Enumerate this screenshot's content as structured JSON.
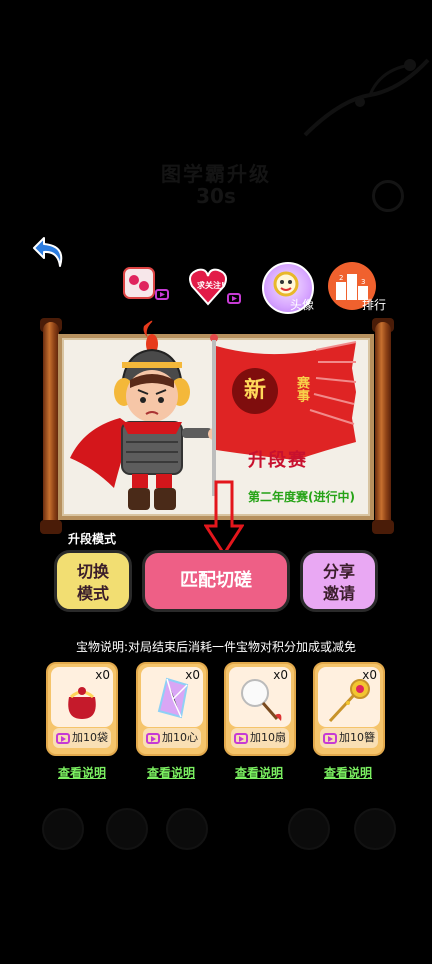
{
  "background": {
    "title": "图学霸升级",
    "timer": "30s"
  },
  "top_icons": {
    "avatar_label": "头像",
    "rank_label": "排行",
    "heart_text": "求关注!"
  },
  "scroll": {
    "flag_new": "新",
    "flag_sai": "赛事",
    "flag_sub": "升段赛",
    "season": "第二年度赛(进行中)"
  },
  "mode": {
    "label": "升段模式",
    "switch_label": "切换模式",
    "match_label": "匹配切磋",
    "share_label": "分享邀请"
  },
  "treasure_note": "宝物说明:对局结束后消耗一件宝物对积分加成或减免",
  "items": [
    {
      "count": "x0",
      "action": "加10袋",
      "link": "查看说明"
    },
    {
      "count": "x0",
      "action": "加10心",
      "link": "查看说明"
    },
    {
      "count": "x0",
      "action": "加10扇",
      "link": "查看说明"
    },
    {
      "count": "x0",
      "action": "加10簪",
      "link": "查看说明"
    }
  ]
}
